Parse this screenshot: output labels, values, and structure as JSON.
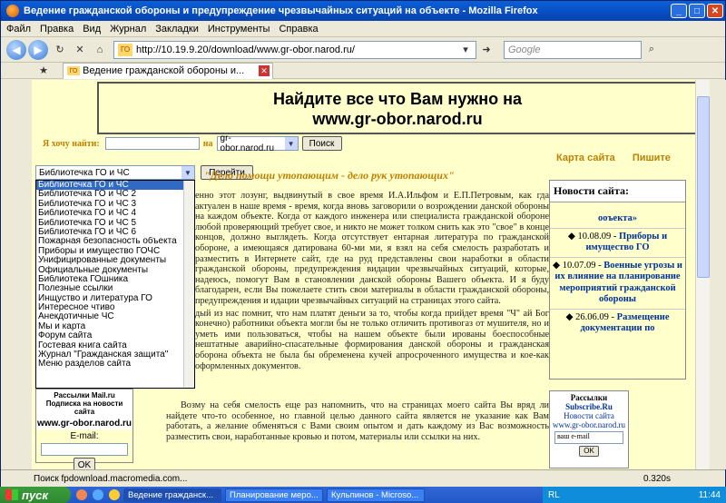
{
  "window": {
    "title": "Ведение гражданской обороны и предупреждение чрезвычайных ситуаций на объекте - Mozilla Firefox"
  },
  "menu": [
    "Файл",
    "Правка",
    "Вид",
    "Журнал",
    "Закладки",
    "Инструменты",
    "Справка"
  ],
  "nav": {
    "url": "http://10.19.9.20/download/www.gr-obor.narod.ru/",
    "favicon": "ГО",
    "search_placeholder": "Google"
  },
  "tab": {
    "label": "Ведение гражданской обороны и...",
    "favicon": "ГО"
  },
  "page": {
    "banner_line1": "Найдите все что Вам нужно на",
    "banner_line2": "www.gr-obor.narod.ru",
    "search_label": "Я хочу найти:",
    "search_on": "на",
    "search_site": "gr-obor.narod.ru",
    "search_button": "Поиск",
    "link_map": "Карта сайта",
    "link_write": "Пишите",
    "select_value": "Библиотечка ГО и ЧС",
    "go_button": "Перейти",
    "dropdown_items": [
      "Библиотечка ГО и ЧС",
      "Библиотечка ГО и ЧС 2",
      "Библиотечка ГО и ЧС 3",
      "Библиотечка ГО и ЧС 4",
      "Библиотечка ГО и ЧС 5",
      "Библиотечка ГО и ЧС 6",
      "Пожарная безопасность объекта",
      "Приборы и имущество ГОЧС",
      "Унифицированные документы",
      "Официальные документы",
      "Библиотека ГОшника",
      "Полезные ссылки",
      "Инщуство и литература ГО",
      "Интересное чтиво",
      "Анекдотичные ЧС",
      "Мы и карта",
      "Форум сайта",
      "Гостевая книга сайта",
      "Журнал \"Гражданская защита\"",
      "Меню разделов сайта"
    ],
    "heading": "\"Дело помощи утопающим  - дело рук утопающих\"",
    "article_p1": "енно этот лозунг, выдвинутый в свое время И.А.Ильфом и Е.П.Петровым, как гда актуален в наше время - время, когда вновь заговорили о возрождении данской обороны на каждом объекте. Когда от каждого инженера или специалиста гражданской обороне любой проверяющий требует свое, и никто не может толком снить как это \"свое\" в конце концов, должно выглядеть. Когда отсутствует ентарная литература по гражданской обороне, а имеющаяся датирована 60-ми ми, я взял на себя смелость разработать и разместить в Интернете сайт, где на руд представлены свои наработки в области гражданской обороны, предупреждения видации чрезвычайных ситуаций, которые, надеюсь, помогут Вам в становлении данской обороны Вашего объекта. И я буду благодарен, если Вы пожелаете стить свои материалы в области гражданской обороны, предупреждения и идации чрезвычайных ситуаций на страницах этого сайта.",
    "article_p2": "дый из нас помнит, что нам платят деньги за то, чтобы когда прийдет время \"Ч\" ай Бог конечно) работники объекта могли бы не только отличить противогаз от мушителя, но и уметь ими пользоваться, чтобы на нашем объекте были ированы боеспособные нештатные аварийно-спасательные формирования данской обороны и гражданская оборона объекта не была бы обременена кучей апросроченного имущества и кое-как оформленных документов.",
    "article_p3": "Возму на себя смелость еще раз напомнить, что на страницах моего сайта Вы вряд ли найдете что-то особенное, но главной целью данного сайта является не указание как Вам работать, а желание обменяться с Вами своим опытом и дать каждому из Вас возможность разместить свои, наработанные кровью и потом, материалы или ссылки на них.",
    "news_title": "Новости сайта:",
    "news_first": "ооъекта»",
    "news_items": [
      {
        "date": "10.08.09 -",
        "text": "Приборы и имущество ГО"
      },
      {
        "date": "10.07.09 -",
        "text": "Военные угрозы и их влияние на планирование мероприятий гражданской обороны"
      },
      {
        "date": "26.06.09 -",
        "text": "Размещение документации по"
      }
    ],
    "subscribe_title": "Рассылки Mail.ru Подписка на новости сайта",
    "subscribe_url": "www.gr-obor.narod.ru",
    "email_label": "E-mail:",
    "ok_button": "OK",
    "rbox_title": "Рассылки",
    "rbox_sub": "Subscribe.Ru",
    "rbox_news": "Новости сайта",
    "rbox_url": "www.gr-obor.narod.ru",
    "rbox_email": "ваш e-mail",
    "rbox_ok": "OK"
  },
  "status": {
    "text": "Поиск fpdownload.macromedia.com...",
    "time": "0.320s"
  },
  "taskbar": {
    "start": "пуск",
    "tasks": [
      "Ведение гражданск...",
      "Планирование меро...",
      "Кульпинов - Microso..."
    ],
    "lang": "RL",
    "clock": "11:44"
  }
}
